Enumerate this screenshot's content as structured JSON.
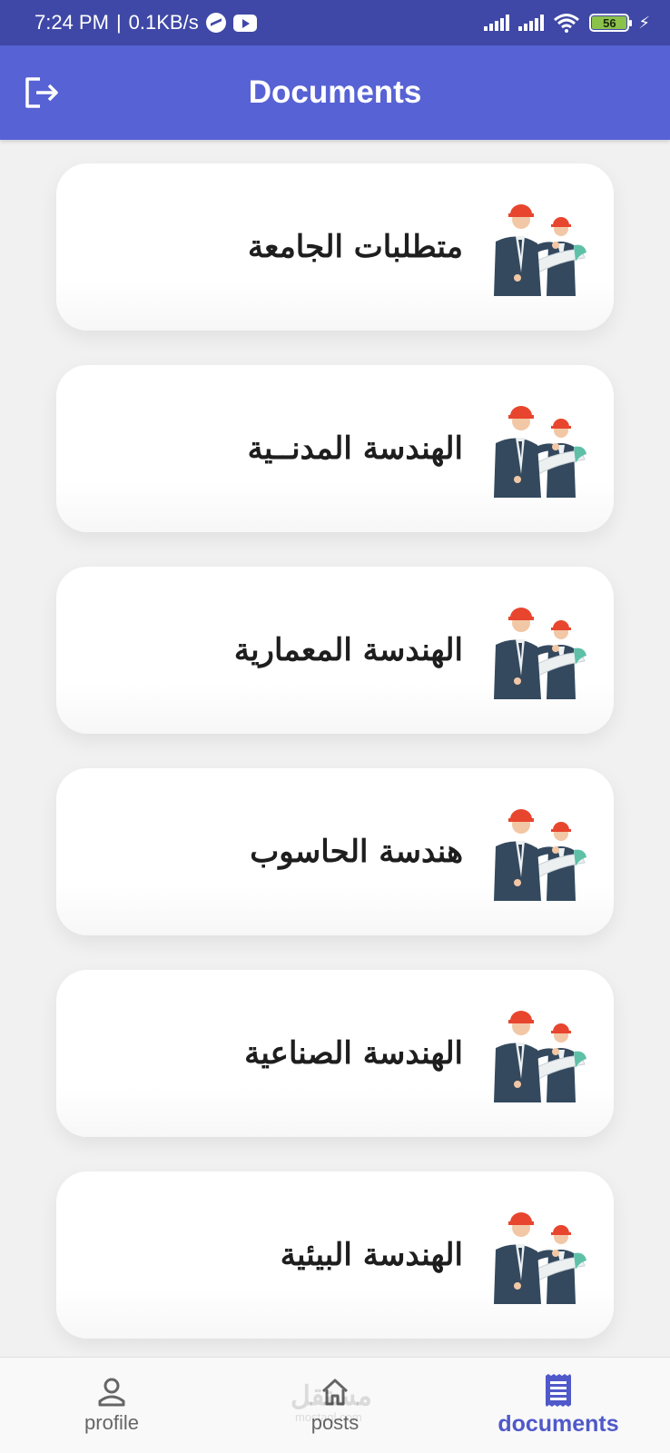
{
  "status_bar": {
    "time": "7:24 PM",
    "separator": "|",
    "net_speed": "0.1KB/s",
    "battery_level": "56",
    "notification_icons": [
      "messenger-icon",
      "youtube-icon"
    ]
  },
  "app_bar": {
    "title": "Documents",
    "leading_icon": "logout-icon"
  },
  "documents": [
    {
      "label": "متطلبات الجامعة",
      "icon": "engineers-icon"
    },
    {
      "label": "الهندسة المدنــية",
      "icon": "engineers-icon"
    },
    {
      "label": "الهندسة المعمارية",
      "icon": "engineers-icon"
    },
    {
      "label": "هندسة الحاسوب",
      "icon": "engineers-icon"
    },
    {
      "label": "الهندسة الصناعية",
      "icon": "engineers-icon"
    },
    {
      "label": "الهندسة البيئية",
      "icon": "engineers-icon"
    }
  ],
  "bottom_nav": {
    "items": [
      {
        "label": "profile",
        "icon": "person-icon",
        "active": false
      },
      {
        "label": "posts",
        "icon": "home-icon",
        "active": false
      },
      {
        "label": "documents",
        "icon": "document-icon",
        "active": true
      }
    ]
  },
  "watermark": {
    "text": "مستقل",
    "sub": "mostaql.com"
  },
  "colors": {
    "status_bar": "#3f48a6",
    "app_bar": "#5762d5",
    "active_nav": "#5059c9",
    "background": "#f1f1f1",
    "card": "#ffffff"
  }
}
